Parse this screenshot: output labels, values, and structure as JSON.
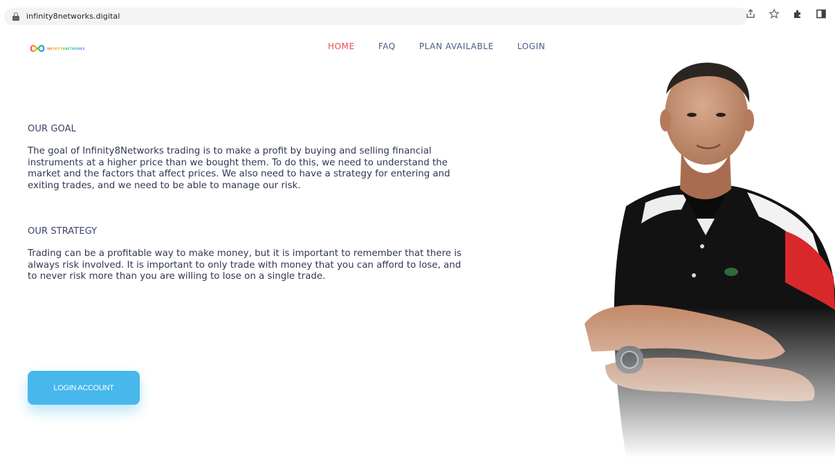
{
  "browser": {
    "url": "infinity8networks.digital",
    "icons": [
      "lock-icon",
      "share-icon",
      "star-icon",
      "extensions-icon",
      "sidepanel-icon"
    ]
  },
  "site": {
    "logo_text": "INFINITY8NETWORKS",
    "nav": [
      {
        "label": "HOME",
        "active": true
      },
      {
        "label": "FAQ",
        "active": false
      },
      {
        "label": "PLAN AVAILABLE",
        "active": false
      },
      {
        "label": "LOGIN",
        "active": false
      }
    ],
    "goal": {
      "title": "OUR GOAL",
      "body": "The goal of Infinity8Networks trading is to make a profit by buying and selling financial instruments at a higher price than we bought them. To do this, we need to understand the market and the factors that affect prices. We also need to have a strategy for entering and exiting trades, and we need to be able to manage our risk."
    },
    "strategy": {
      "title": "OUR STRATEGY",
      "body": "Trading can be a profitable way to make money, but it is important to remember that there is always risk involved. It is important to only trade with money that you can afford to lose, and to never risk more than you are willing to lose on a single trade."
    },
    "cta": {
      "label": "LOGIN ACCOUNT"
    }
  },
  "colors": {
    "accent": "#47b7ec",
    "nav_active": "#f04a54",
    "nav_default": "#4a5a85",
    "text": "#2f3754"
  }
}
